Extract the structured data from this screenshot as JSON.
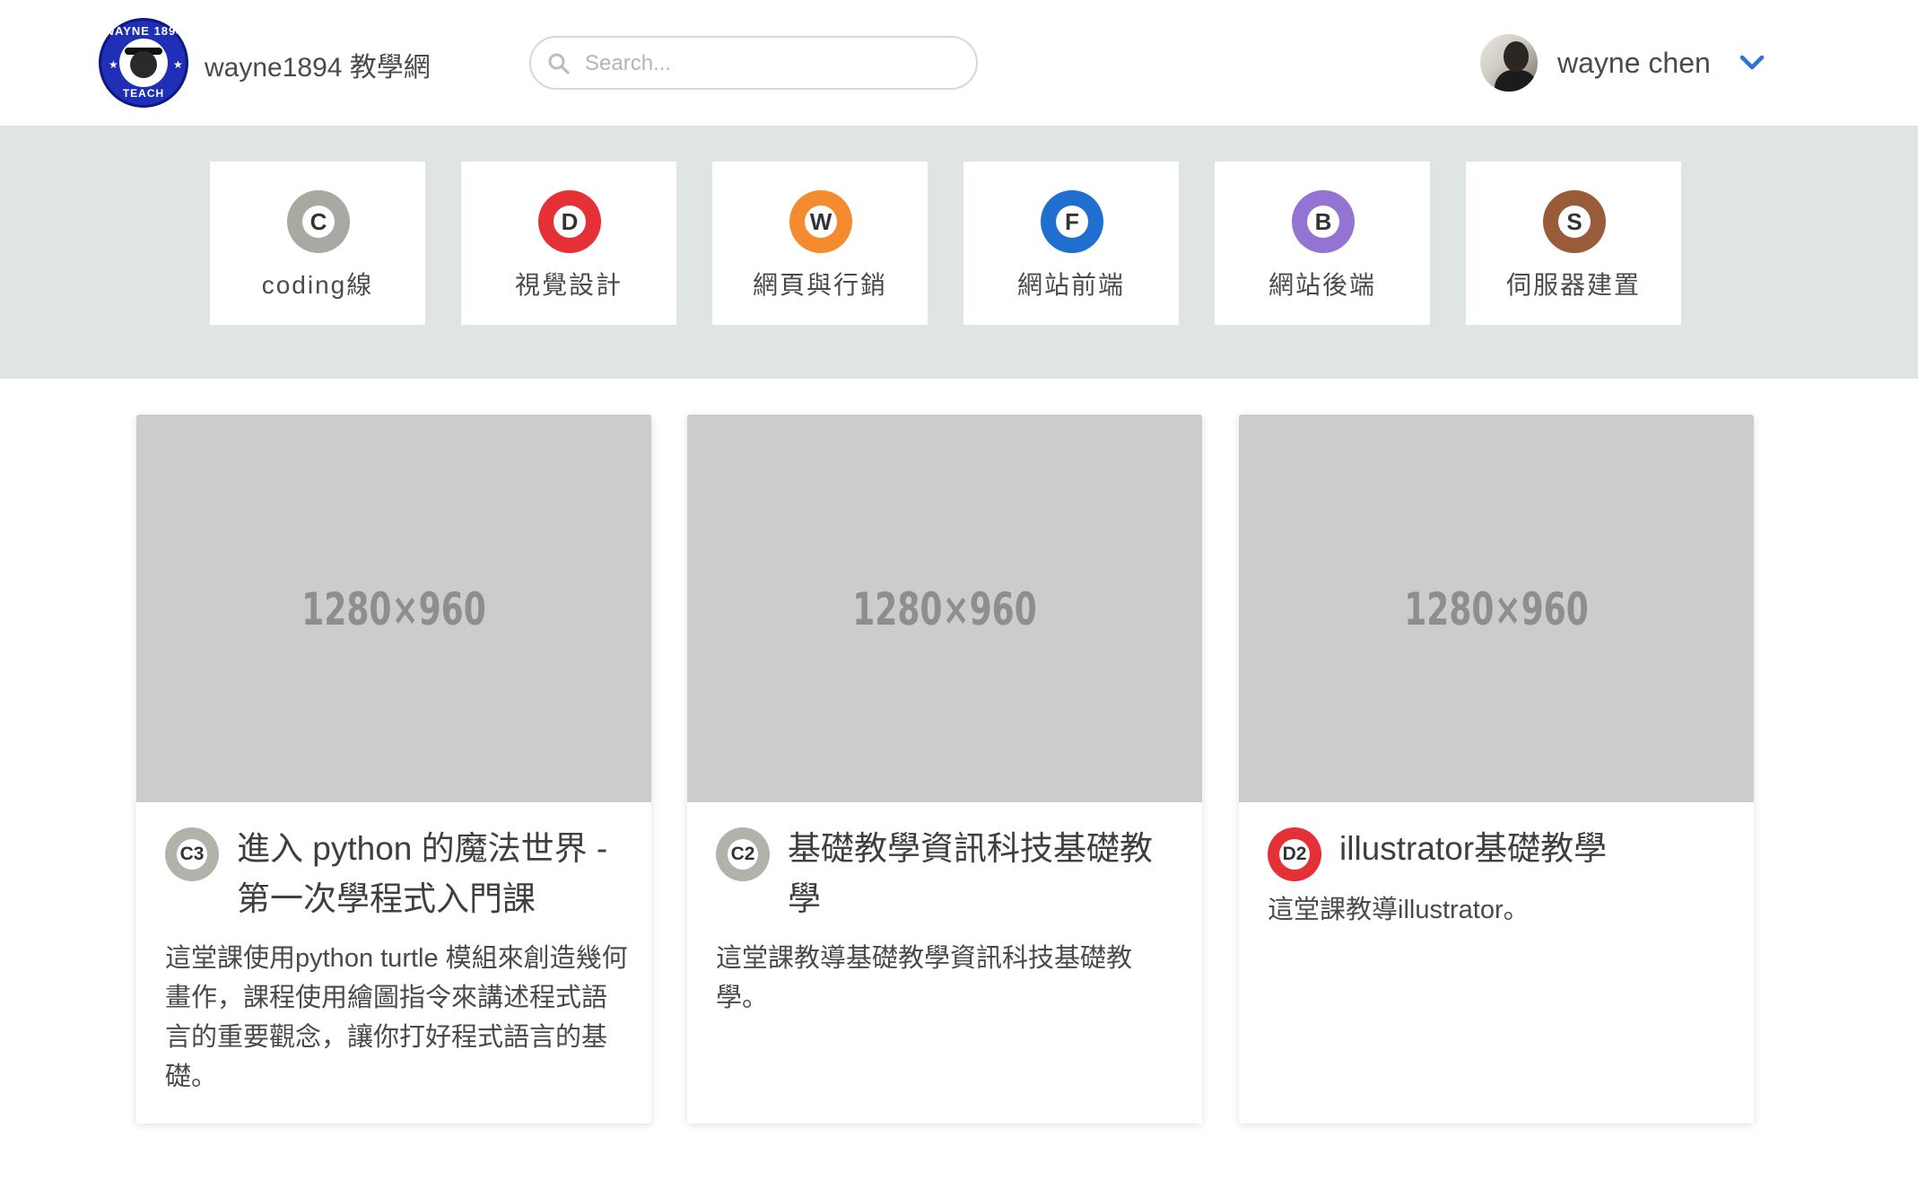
{
  "header": {
    "logo_alt": "WAYNE 1894 TEACH",
    "logo_text_top": "WAYNE 1894",
    "logo_text_bottom": "TEACH",
    "brand": "wayne1894 教學網",
    "search_placeholder": "Search...",
    "search_value": "",
    "user_name": "wayne chen",
    "icons": {
      "search": "search-icon",
      "dropdown": "chevron-down-icon"
    },
    "accent_color": "#2f6fdb"
  },
  "categories": [
    {
      "letter": "C",
      "label": "coding線",
      "color": "#a9a9a1"
    },
    {
      "letter": "D",
      "label": "視覺設計",
      "color": "#e53038"
    },
    {
      "letter": "W",
      "label": "網頁與行銷",
      "color": "#f48b2e"
    },
    {
      "letter": "F",
      "label": "網站前端",
      "color": "#1f6fd1"
    },
    {
      "letter": "B",
      "label": "網站後端",
      "color": "#9374d3"
    },
    {
      "letter": "S",
      "label": "伺服器建置",
      "color": "#9a5b3a"
    }
  ],
  "courses": [
    {
      "thumb_text": "1280×960",
      "badge": "C3",
      "badge_color": "#b2b2aa",
      "title": "進入 python 的魔法世界 - 第一次學程式入門課",
      "desc": "這堂課使用python turtle 模組來創造幾何畫作，課程使用繪圖指令來講述程式語言的重要觀念，讓你打好程式語言的基礎。"
    },
    {
      "thumb_text": "1280×960",
      "badge": "C2",
      "badge_color": "#b2b2aa",
      "title": "基礎教學資訊科技基礎教學",
      "desc": "這堂課教導基礎教學資訊科技基礎教學。"
    },
    {
      "thumb_text": "1280×960",
      "badge": "D2",
      "badge_color": "#e53038",
      "title": "illustrator基礎教學",
      "desc": "這堂課教導illustrator。"
    }
  ]
}
